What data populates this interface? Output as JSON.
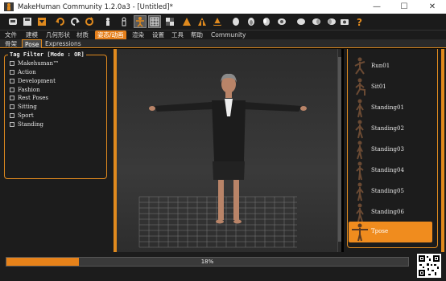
{
  "window": {
    "title": "MakeHuman Community 1.2.0a3 - [Untitled]*",
    "minimize_glyph": "—",
    "maximize_glyph": "☐",
    "close_glyph": "✕"
  },
  "toolbar_icons": [
    "new-file-icon",
    "save-icon",
    "export-icon",
    "undo-icon",
    "redo-icon",
    "reset-icon",
    "smooth-icon",
    "wireframe-icon",
    "pose-icon",
    "grid-icon",
    "checker-icon",
    "front-view-icon",
    "back-view-icon",
    "left-view-icon",
    "right-view-icon",
    "top-view-icon",
    "bottom-view-icon",
    "reset-camera-icon",
    "screenshot-icon",
    "help-icon"
  ],
  "menu": {
    "items": [
      "文件",
      "建模",
      "几何形状",
      "材质",
      "姿态/动画",
      "渲染",
      "设置",
      "工具",
      "帮助",
      "Community"
    ],
    "active_index": 4
  },
  "subtabs": {
    "items": [
      "骨架",
      "Pose",
      "Expressions"
    ],
    "active_index": 1
  },
  "tag_filter": {
    "title": "Tag Filter [Mode : OR]",
    "tags": [
      "Makehuman™",
      "Action",
      "Development",
      "Fashion",
      "Rest Poses",
      "Sitting",
      "Sport",
      "Standing"
    ]
  },
  "poses": {
    "items": [
      "Run01",
      "Sit01",
      "Standing01",
      "Standing02",
      "Standing03",
      "Standing04",
      "Standing05",
      "Standing06",
      "Tpose"
    ],
    "selected": "Tpose"
  },
  "status": {
    "progress_text": "18%",
    "progress_value": 0.18
  },
  "colors": {
    "accent": "#e08a1e",
    "selected": "#f08c1e",
    "background": "#1c1c1c"
  }
}
